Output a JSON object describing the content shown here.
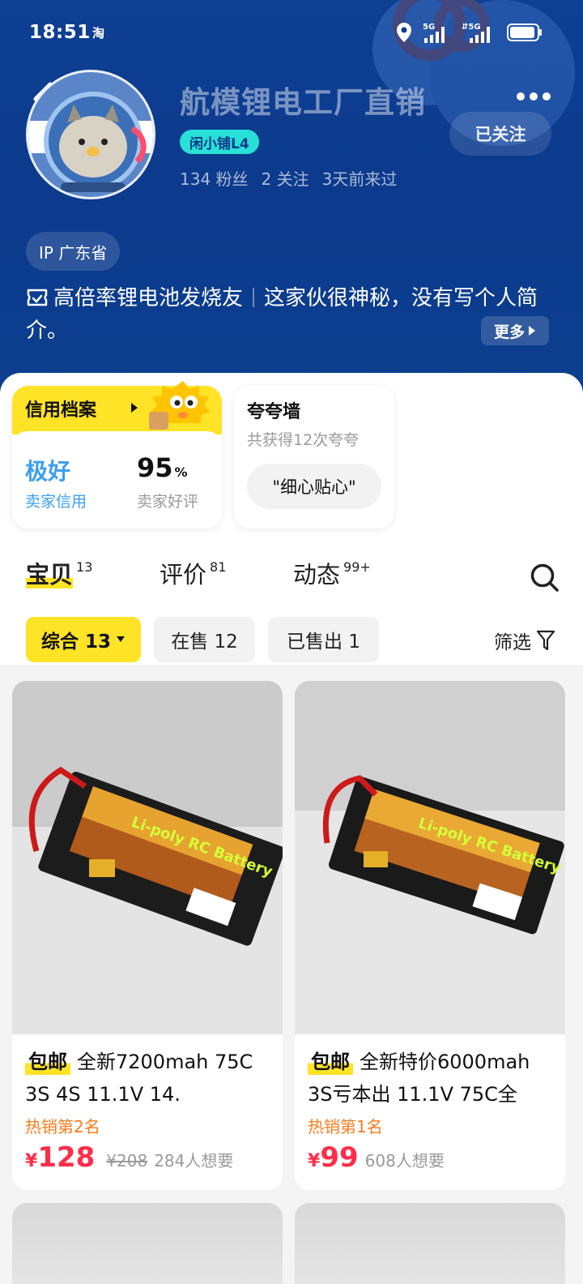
{
  "status": {
    "time": "18:51",
    "app": "淘",
    "net1": "5G",
    "net2": "5G"
  },
  "shop": {
    "name": "航模锂电工厂直销",
    "level": "闲小铺L4",
    "follow_label": "已关注",
    "stats": [
      "134 粉丝",
      "2 关注",
      "3天前来过"
    ],
    "ip": "IP 广东省",
    "tag": "高倍率锂电池发烧友",
    "intro": "这家伙很神秘，没有写个人简介。",
    "more_label": "更多"
  },
  "credit": {
    "title": "信用档案",
    "level": "极好",
    "level_label": "卖家信用",
    "rate": "95",
    "rate_unit": "%",
    "rate_label": "卖家好评"
  },
  "praise": {
    "title": "夸夸墙",
    "sub": "共获得12次夸夸",
    "chip": "\"细心贴心\""
  },
  "tabs": [
    {
      "label": "宝贝",
      "count": "13"
    },
    {
      "label": "评价",
      "count": "81"
    },
    {
      "label": "动态",
      "count": "99+"
    }
  ],
  "filters": {
    "chips": [
      "综合 13",
      "在售 12",
      "已售出 1"
    ],
    "filter_label": "筛选"
  },
  "products": [
    {
      "badge": "包邮",
      "title": "全新7200mah 75C 3S 4S 11.1V  14.",
      "rank": "热销第2名",
      "currency": "¥",
      "price": "128",
      "original": "¥208",
      "want": "284人想要"
    },
    {
      "badge": "包邮",
      "title": "全新特价6000mah 3S亏本出 11.1V 75C全",
      "rank": "热销第1名",
      "currency": "¥",
      "price": "99",
      "original": "",
      "want": "608人想要"
    }
  ],
  "colors": {
    "header": "#0c3a8c",
    "accent": "#ffe326",
    "price": "#ff2d4a",
    "rank": "#ff7a1a",
    "credit": "#3b9ff1"
  }
}
